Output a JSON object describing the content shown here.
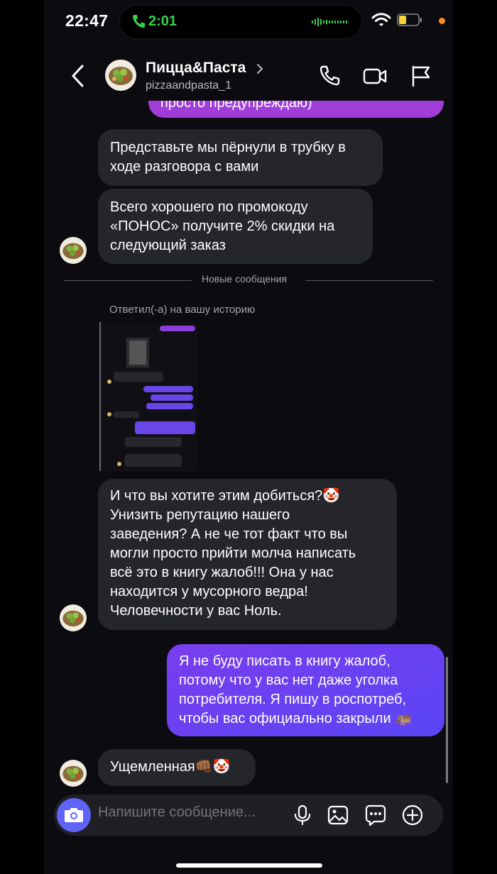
{
  "status_bar": {
    "time": "22:47",
    "call_duration": "2:01",
    "call_color": "#35d24e"
  },
  "header": {
    "name": "Пицца&Паста",
    "username": "pizzaandpasta_1",
    "icons": [
      "back-icon",
      "phone-icon",
      "video-icon",
      "flag-icon"
    ]
  },
  "messages": {
    "cut_top": "просто предупреждаю)",
    "m1": [
      "Представьте мы пёрнули в трубку в",
      "ходе разговора с вами"
    ],
    "m2": [
      "Всего хорошего по промокоду",
      "«ПОНОС» получите 2% скидки на",
      "следующий заказ"
    ],
    "divider": "Новые сообщения",
    "reply_note": "Ответил(-а) на вашу историю",
    "m3": [
      "И что вы хотите этим добиться?🤡",
      "Унизить репутацию нашего",
      "заведения? А не че тот факт что вы",
      "могли просто прийти молча написать",
      "всё это в книгу жалоб!!! Она у нас",
      "находится у мусорного ведра!",
      "Человечности у вас Ноль."
    ],
    "m4": [
      "Я не буду писать в книгу жалоб,",
      "потому что у вас нет даже уголка",
      "потребителя. Я пишу в роспотреб,",
      "чтобы вас официально закрыли 🦛"
    ],
    "m5": "Ущемленная👊🏾🤡"
  },
  "composer": {
    "placeholder": "Напишите сообщение...",
    "icons": [
      "camera-icon",
      "microphone-icon",
      "gallery-icon",
      "sticker-icon",
      "add-icon"
    ]
  },
  "colors": {
    "background": "#0c0c10",
    "received_bubble": "#25252c",
    "sent_bubble": "#6f3ff0",
    "accent": "#5f63f6"
  }
}
